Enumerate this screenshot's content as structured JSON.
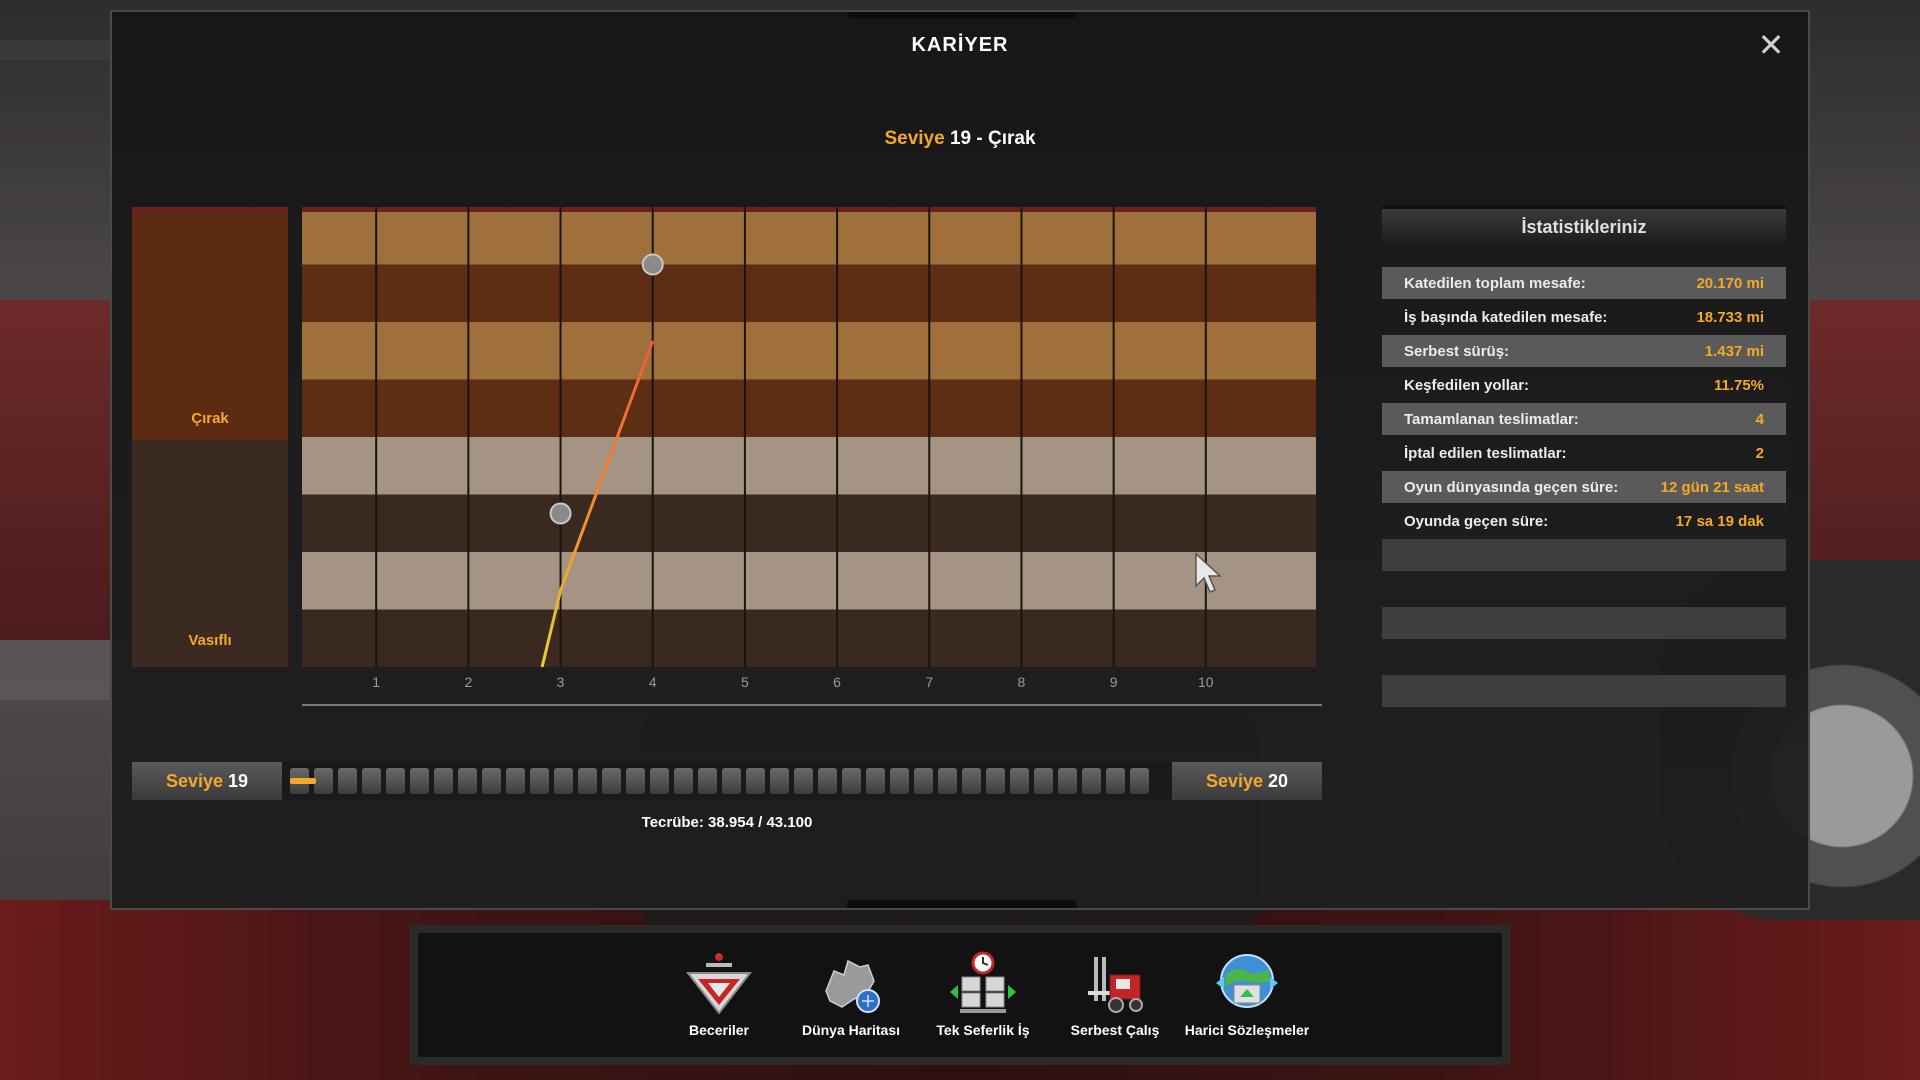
{
  "window": {
    "title": "KARİYER",
    "close_glyph": "✕",
    "level_word": "Seviye",
    "level_rest": " 19 - Çırak"
  },
  "ranks": {
    "upper": "Çırak",
    "lower": "Vasıflı"
  },
  "chart_data": {
    "type": "line",
    "categories": [
      "1",
      "2",
      "3",
      "4",
      "5",
      "6",
      "7",
      "8",
      "9",
      "10"
    ],
    "band_colors_upper": [
      "#a0703c",
      "#5d2e13"
    ],
    "band_colors_lower": [
      "#a59384",
      "#3a2920"
    ],
    "series": [
      {
        "points": [
          [
            2.8,
            0.0
          ],
          [
            3.0,
            1.33
          ],
          [
            4.0,
            5.67
          ]
        ],
        "markers": [
          [
            3.0,
            2.67
          ],
          [
            4.0,
            7.0
          ]
        ]
      }
    ]
  },
  "stats": {
    "header": "İstatistikleriniz",
    "rows": [
      {
        "label": "Katedilen toplam mesafe:",
        "value": "20.170 mi"
      },
      {
        "label": "İş başında katedilen mesafe:",
        "value": "18.733 mi"
      },
      {
        "label": "Serbest sürüş:",
        "value": "1.437 mi"
      },
      {
        "label": "Keşfedilen yollar:",
        "value": "11.75%"
      },
      {
        "label": "Tamamlanan teslimatlar:",
        "value": "4"
      },
      {
        "label": "İptal edilen teslimatlar:",
        "value": "2"
      },
      {
        "label": "Oyun dünyasında geçen süre:",
        "value": "12 gün 21 saat"
      },
      {
        "label": "Oyunda geçen süre:",
        "value": "17 sa 19 dak"
      }
    ]
  },
  "xp": {
    "level_word": "Seviye",
    "current_level": "19",
    "next_level": "20",
    "experience_text": "Tecrübe: 38.954 / 43.100",
    "progress": 0.03,
    "accent": "#f6a828"
  },
  "toolbar": {
    "items": [
      {
        "label": "Beceriler",
        "icon": "skills-icon"
      },
      {
        "label": "Dünya Haritası",
        "icon": "world-map-icon"
      },
      {
        "label": "Tek Seferlik İş",
        "icon": "freight-market-icon"
      },
      {
        "label": "Serbest Çalış",
        "icon": "cargo-market-icon"
      },
      {
        "label": "Harici Sözleşmeler",
        "icon": "external-contracts-icon"
      }
    ]
  }
}
